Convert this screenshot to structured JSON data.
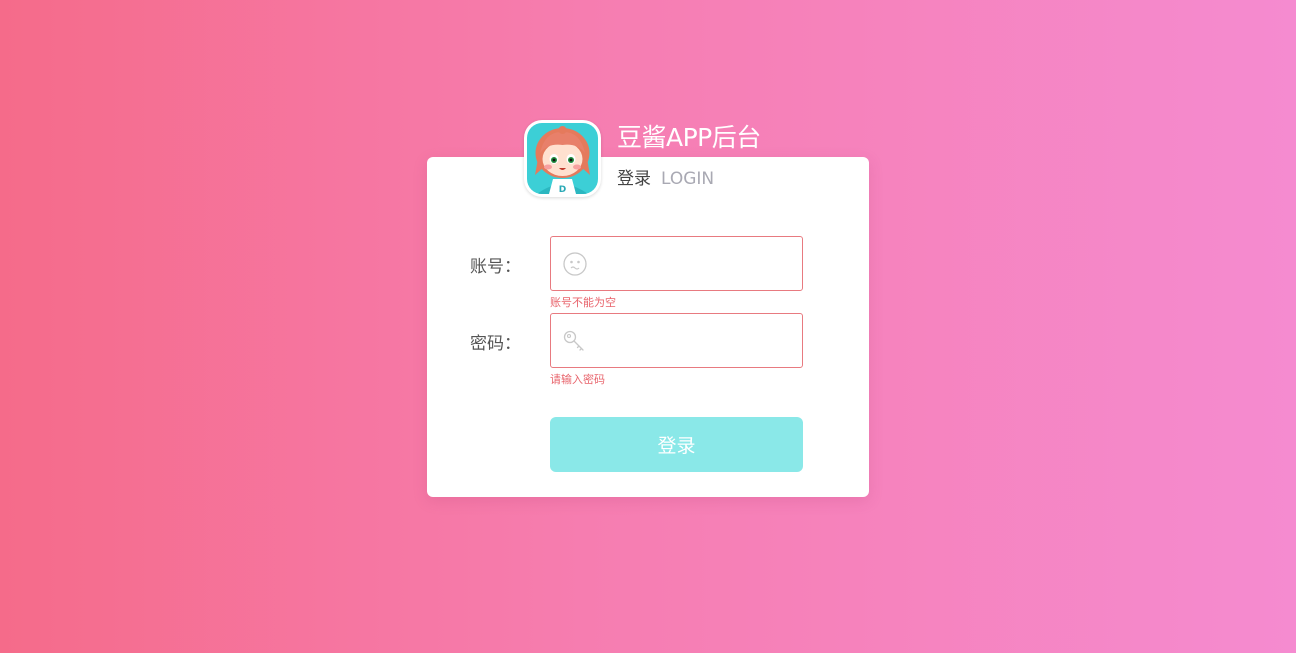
{
  "header": {
    "app_title": "豆酱APP后台",
    "subtitle_cn": "登录",
    "subtitle_en": "LOGIN"
  },
  "form": {
    "account": {
      "label": "账号：",
      "value": "",
      "error": "账号不能为空",
      "icon": "face-icon"
    },
    "password": {
      "label": "密码：",
      "value": "",
      "error": "请输入密码",
      "icon": "key-icon"
    },
    "submit_label": "登录"
  },
  "colors": {
    "background_start": "#f56b8a",
    "background_end": "#f58bd0",
    "button": "#8ae8e8",
    "error": "#e8646c",
    "input_border_error": "#e87a80"
  }
}
